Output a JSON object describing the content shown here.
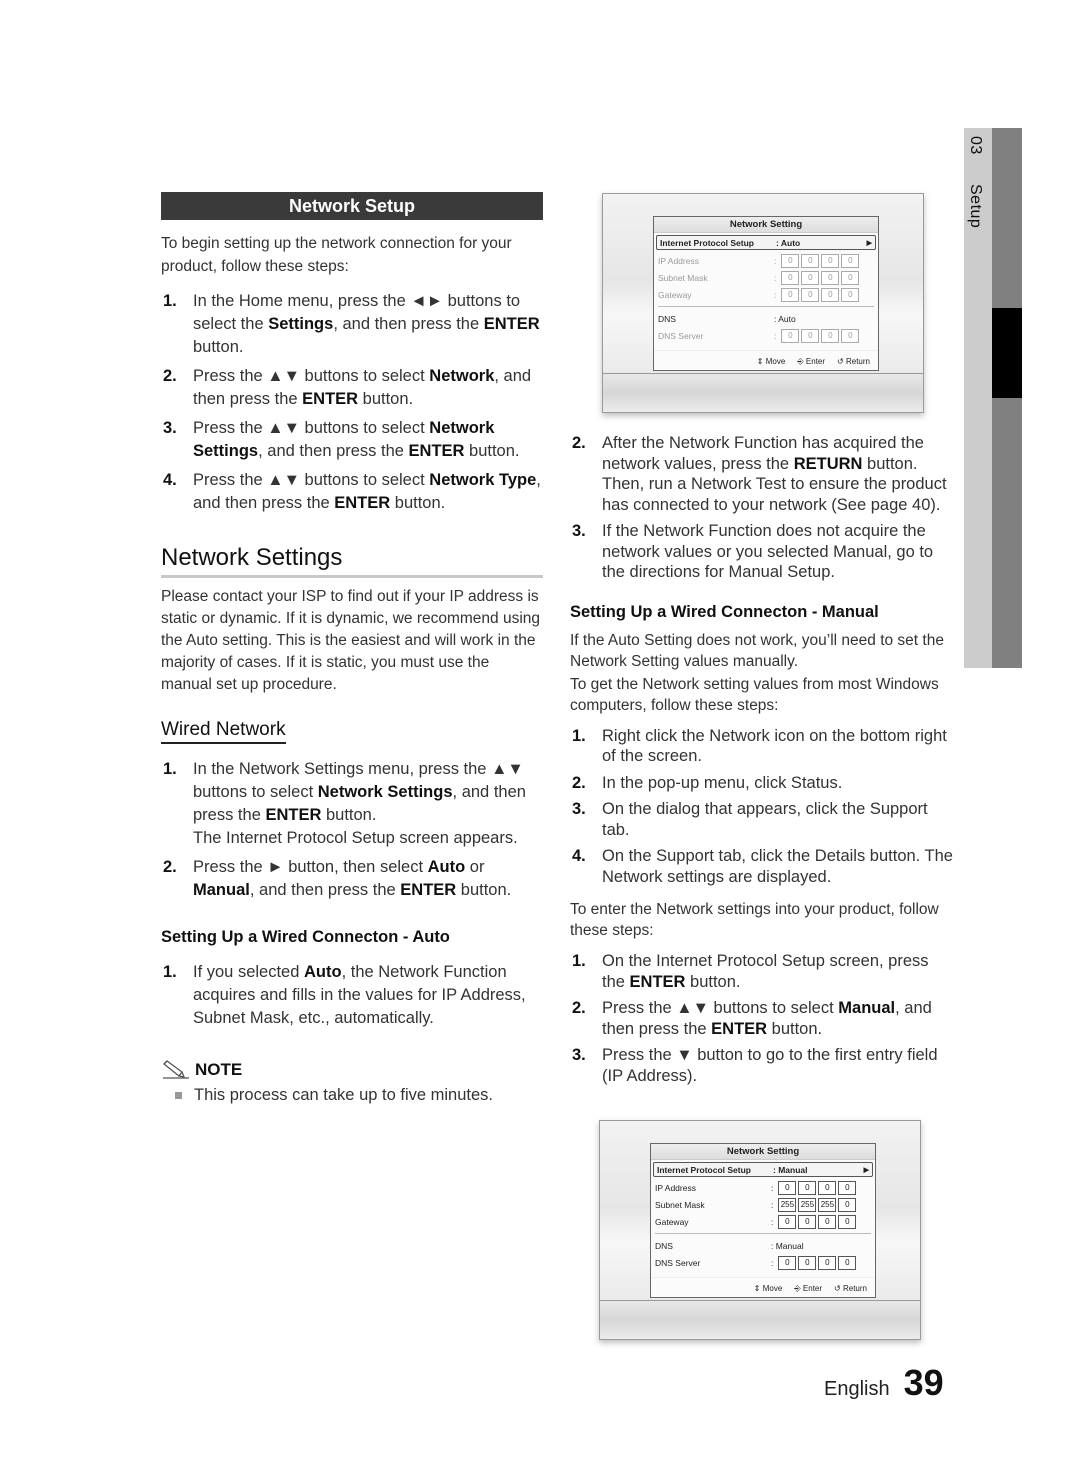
{
  "side_tab": {
    "chapter": "03",
    "section": "Setup"
  },
  "network_setup": {
    "heading": "Network Setup",
    "intro": "To begin setting up the network connection for your product, follow these steps:",
    "steps": [
      {
        "num": "1.",
        "parts": [
          "In the Home menu, press the ◄► buttons to select the ",
          {
            "b": "Settings"
          },
          ", and then press the ",
          {
            "b": "ENTER"
          },
          " button."
        ]
      },
      {
        "num": "2.",
        "parts": [
          "Press the ▲▼ buttons to select ",
          {
            "b": "Network"
          },
          ", and then press the ",
          {
            "b": "ENTER"
          },
          " button."
        ]
      },
      {
        "num": "3.",
        "parts": [
          "Press the ▲▼ buttons to select ",
          {
            "b": "Network Settings"
          },
          ", and then press the ",
          {
            "b": "ENTER"
          },
          " button."
        ]
      },
      {
        "num": "4.",
        "parts": [
          "Press the ▲▼ buttons to select ",
          {
            "b": "Network Type"
          },
          ", and then press the ",
          {
            "b": "ENTER"
          },
          " button."
        ]
      }
    ]
  },
  "network_settings": {
    "heading": "Network Settings",
    "para": "Please contact your ISP to find out if your IP address is static or dynamic. If it is dynamic, we recommend using the Auto setting. This is the easiest and will work in the majority of cases. If it is static, you must use the manual set up procedure."
  },
  "wired_network": {
    "heading": "Wired Network",
    "steps": [
      {
        "num": "1.",
        "parts": [
          "In the Network Settings menu, press the ▲▼ buttons to select ",
          {
            "b": "Network Settings"
          },
          ", and then press the ",
          {
            "b": "ENTER"
          },
          " button.",
          {
            "br": true
          },
          "The Internet Protocol Setup screen appears."
        ]
      },
      {
        "num": "2.",
        "parts": [
          "Press the ► button, then select ",
          {
            "b": "Auto"
          },
          " or ",
          {
            "b": "Manual"
          },
          ", and then press the ",
          {
            "b": "ENTER"
          },
          " button."
        ]
      }
    ]
  },
  "auto_setup": {
    "heading": "Setting Up a Wired Connecton - Auto",
    "steps": [
      {
        "num": "1.",
        "parts": [
          "If you selected ",
          {
            "b": "Auto"
          },
          ", the Network Function acquires and fills in the values for IP Address, Subnet Mask, etc., automatically."
        ]
      },
      {
        "num": "2.",
        "parts": [
          "After the Network Function has acquired the network values, press the ",
          {
            "b": "RETURN"
          },
          " button. Then, run a Network Test to ensure the product has connected to your network (See page 40)."
        ]
      },
      {
        "num": "3.",
        "parts": [
          "If the Network Function does not acquire the network values or you selected Manual, go to the directions for Manual Setup."
        ]
      }
    ],
    "note_label": "NOTE",
    "note_items": [
      "This process can take up to five minutes."
    ]
  },
  "manual_setup": {
    "heading": "Setting Up a Wired Connecton - Manual",
    "para1": "If the Auto Setting does not work, you’ll need to set the Network Setting values manually.",
    "para2": "To get the Network setting values from most Windows computers, follow these steps:",
    "windows_steps": [
      {
        "num": "1.",
        "parts": [
          "Right click the Network icon on the bottom right of the screen."
        ]
      },
      {
        "num": "2.",
        "parts": [
          "In the pop-up menu, click Status."
        ]
      },
      {
        "num": "3.",
        "parts": [
          "On the dialog that appears, click the Support tab."
        ]
      },
      {
        "num": "4.",
        "parts": [
          "On the Support tab, click the Details button. The Network settings are displayed."
        ]
      }
    ],
    "para3": "To enter the Network settings into your product, follow these steps:",
    "product_steps": [
      {
        "num": "1.",
        "parts": [
          "On the Internet Protocol Setup screen, press the ",
          {
            "b": "ENTER"
          },
          " button."
        ]
      },
      {
        "num": "2.",
        "parts": [
          "Press the ▲▼ buttons to select ",
          {
            "b": "Manual"
          },
          ", and then press the ",
          {
            "b": "ENTER"
          },
          " button."
        ]
      },
      {
        "num": "3.",
        "parts": [
          "Press the ▼ button to go to the first entry field (IP Address)."
        ]
      }
    ]
  },
  "screens": {
    "auto": {
      "title": "Network Setting",
      "ip_setup_label": "Internet Protocol Setup",
      "ip_setup_value": ": Auto",
      "rows": [
        {
          "label": "IP Address",
          "values": [
            "0",
            "0",
            "0",
            "0"
          ]
        },
        {
          "label": "Subnet Mask",
          "values": [
            "0",
            "0",
            "0",
            "0"
          ]
        },
        {
          "label": "Gateway",
          "values": [
            "0",
            "0",
            "0",
            "0"
          ]
        }
      ],
      "dns_label": "DNS",
      "dns_value": ": Auto",
      "dns_server_label": "DNS Server",
      "dns_server_values": [
        "0",
        "0",
        "0",
        "0"
      ],
      "footer": {
        "move": "Move",
        "enter": "Enter",
        "return": "Return"
      }
    },
    "manual": {
      "title": "Network Setting",
      "ip_setup_label": "Internet Protocol Setup",
      "ip_setup_value": ": Manual",
      "rows": [
        {
          "label": "IP Address",
          "values": [
            "0",
            "0",
            "0",
            "0"
          ]
        },
        {
          "label": "Subnet Mask",
          "values": [
            "255",
            "255",
            "255",
            "0"
          ]
        },
        {
          "label": "Gateway",
          "values": [
            "0",
            "0",
            "0",
            "0"
          ]
        }
      ],
      "dns_label": "DNS",
      "dns_value": ": Manual",
      "dns_server_label": "DNS Server",
      "dns_server_values": [
        "0",
        "0",
        "0",
        "0"
      ],
      "footer": {
        "move": "Move",
        "enter": "Enter",
        "return": "Return"
      }
    }
  },
  "footer": {
    "language": "English",
    "page_number": "39"
  }
}
